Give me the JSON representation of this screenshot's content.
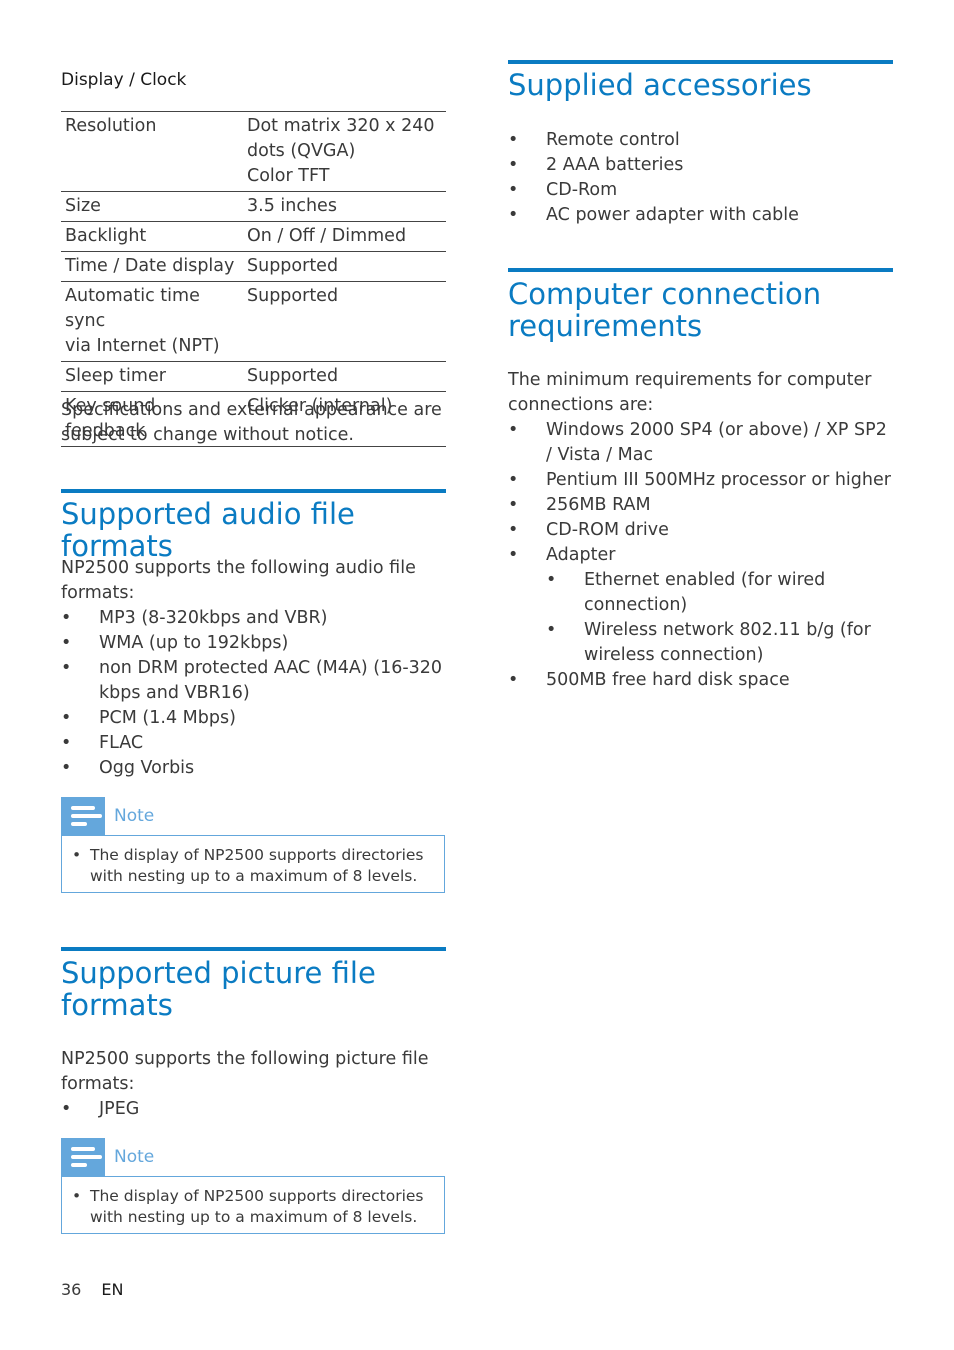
{
  "left": {
    "display_clock": {
      "title": "Display / Clock",
      "rows": [
        {
          "key": "Resolution",
          "value": [
            "Dot matrix 320 x 240",
            "dots (QVGA)",
            "Color TFT"
          ]
        },
        {
          "key": "Size",
          "value": [
            "3.5 inches"
          ]
        },
        {
          "key": "Backlight",
          "value": [
            "On / Off / Dimmed"
          ]
        },
        {
          "key": "Time / Date display",
          "value": [
            "Supported"
          ]
        },
        {
          "key": "Automatic time sync via Internet (NPT)",
          "key_lines": [
            "Automatic time sync",
            "via Internet (NPT)"
          ],
          "value": [
            "Supported"
          ]
        },
        {
          "key": "Sleep timer",
          "value": [
            "Supported"
          ]
        },
        {
          "key": "Key sound feedback",
          "value": [
            "Clicker (internal)"
          ]
        }
      ],
      "disclaimer": [
        "Specifications and external appearance are",
        "subject to change without notice."
      ]
    },
    "audio": {
      "heading": "Supported audio file formats",
      "intro": [
        "NP2500 supports the following audio file",
        "formats:"
      ],
      "items": [
        [
          "MP3 (8-320kbps and VBR)"
        ],
        [
          "WMA (up to 192kbps)"
        ],
        [
          "non DRM protected AAC (M4A) (16-320",
          "kbps and VBR16)"
        ],
        [
          "PCM (1.4 Mbps)"
        ],
        [
          "FLAC"
        ],
        [
          "Ogg Vorbis"
        ]
      ],
      "note": {
        "label": "Note",
        "lines": [
          "The display of NP2500 supports directories",
          "with nesting up to a maximum of 8 levels."
        ]
      }
    },
    "picture": {
      "heading": [
        "Supported picture file",
        "formats"
      ],
      "intro": [
        "NP2500 supports the following picture file",
        "formats:"
      ],
      "items": [
        "JPEG"
      ],
      "note": {
        "label": "Note",
        "lines": [
          "The display of NP2500 supports directories",
          "with nesting up to a maximum of 8 levels."
        ]
      }
    }
  },
  "right": {
    "accessories": {
      "heading": "Supplied accessories",
      "items": [
        "Remote control",
        "2 AAA batteries",
        "CD-Rom",
        "AC power adapter with cable"
      ]
    },
    "computer": {
      "heading": [
        "Computer connection",
        "requirements"
      ],
      "intro": [
        "The minimum requirements for computer",
        "connections are:"
      ],
      "items": [
        [
          "Windows 2000 SP4 (or above) / XP SP2",
          "/ Vista / Mac"
        ],
        [
          "Pentium III 500MHz processor or higher"
        ],
        [
          "256MB RAM"
        ],
        [
          "CD-ROM drive"
        ],
        [
          "Adapter"
        ],
        [
          "500MB free hard disk space"
        ]
      ],
      "adapter_subitems": [
        [
          "Ethernet enabled (for wired",
          "connection)"
        ],
        [
          "Wireless network 802.11 b/g (for",
          "wireless connection)"
        ]
      ]
    }
  },
  "footer": {
    "page_number": "36",
    "language": "EN"
  },
  "bullet": "•",
  "colors": {
    "accent": "#0a7bc2",
    "note": "#64a7dc",
    "text": "#3a3a3a"
  }
}
